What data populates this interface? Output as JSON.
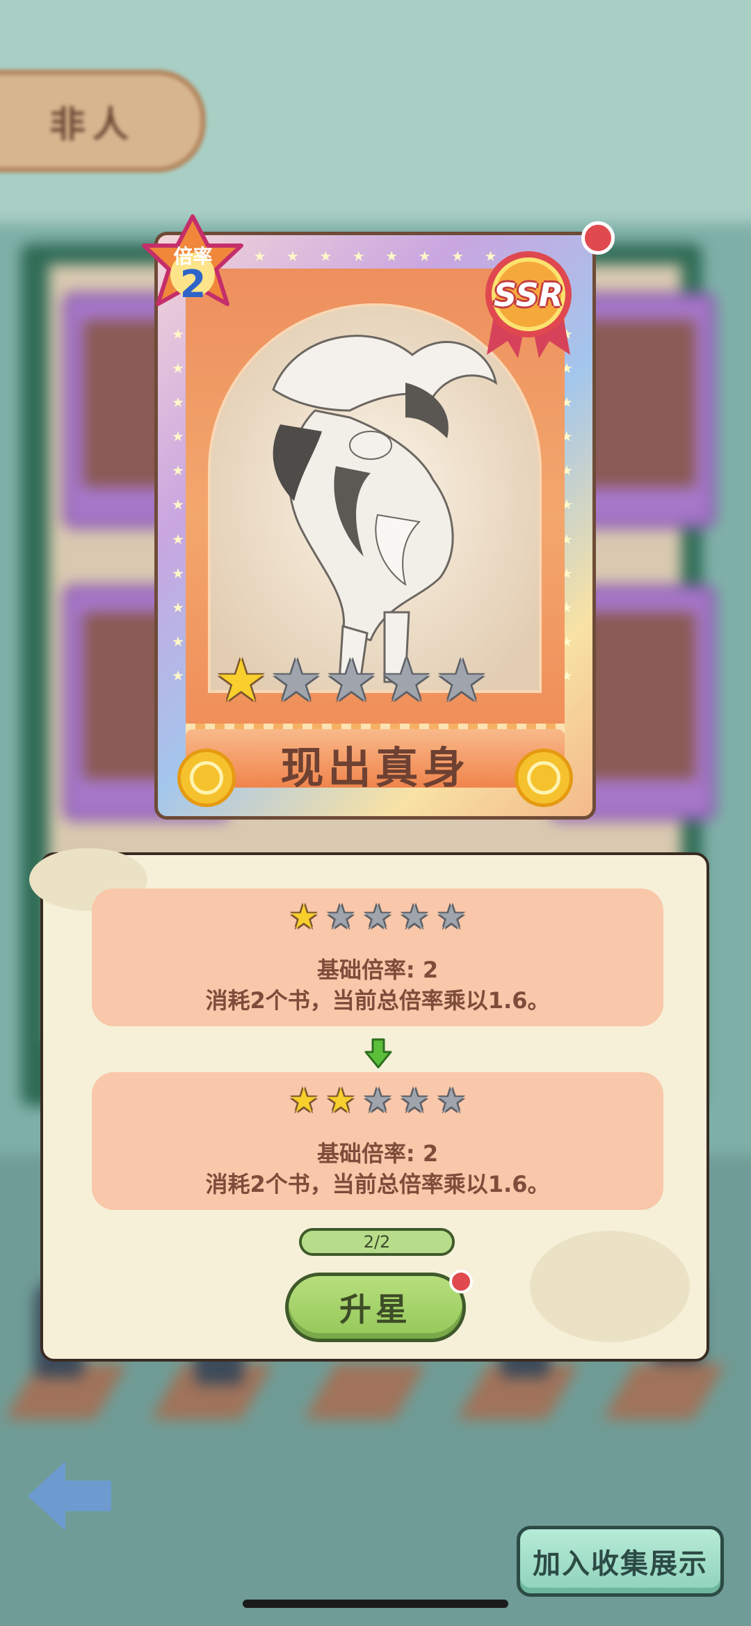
{
  "header": {
    "tab_label": "非人"
  },
  "card": {
    "multiplier_label": "倍率",
    "multiplier_value": "2",
    "rarity": "SSR",
    "name": "现出真身",
    "stars_filled": 1,
    "stars_total": 5
  },
  "upgrade": {
    "current": {
      "stars_filled": 1,
      "stars_total": 5,
      "line1": "基础倍率: 2",
      "line2": "消耗2个书，当前总倍率乘以1.6。"
    },
    "next": {
      "stars_filled": 2,
      "stars_total": 5,
      "line1": "基础倍率: 2",
      "line2": "消耗2个书，当前总倍率乘以1.6。"
    },
    "progress_text": "2/2",
    "progress_fraction": 1.0,
    "button_label": "升星"
  },
  "footer": {
    "collect_button": "加入收集展示"
  },
  "colors": {
    "panel_bg": "#f6f0d8",
    "level_box": "#f9c7a9",
    "text_brown": "#7d4c3a",
    "button_green": "#94c75a",
    "star_gold": "#f8cf2c",
    "star_grey": "#a0a5ad",
    "notify_red": "#e04a4e"
  },
  "icons": {
    "star_on": "★",
    "star_off": "★",
    "card_border_star": "★"
  }
}
